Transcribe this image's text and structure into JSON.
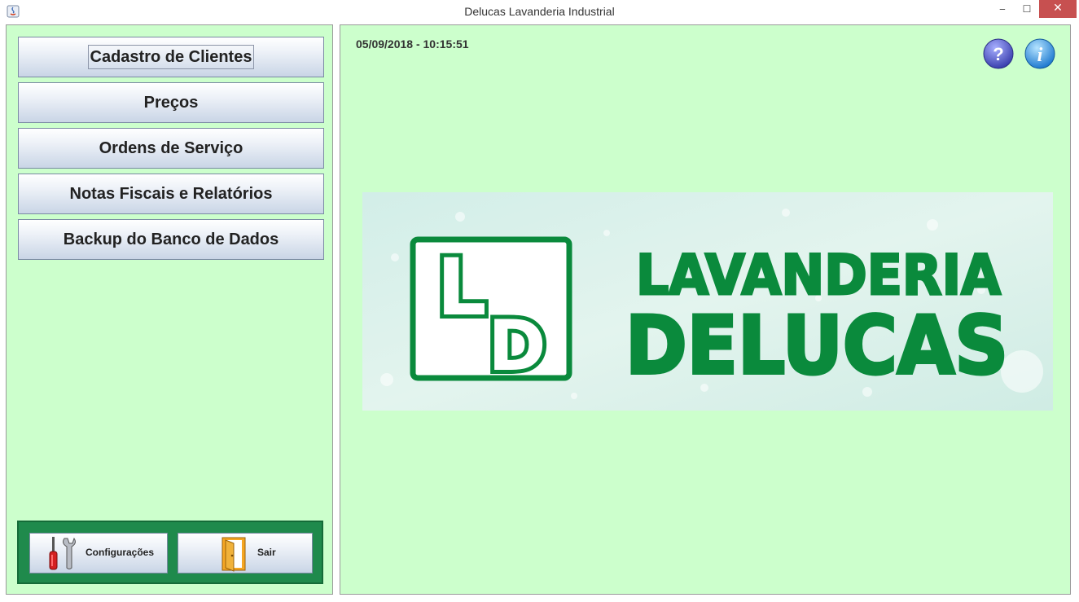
{
  "window": {
    "title": "Delucas Lavanderia Industrial",
    "minimize": "‒",
    "maximize": "☐",
    "close": "✕"
  },
  "menu": {
    "clients": "Cadastro de Clientes",
    "prices": "Preços",
    "orders": "Ordens de Serviço",
    "invoices": "Notas Fiscais e Relatórios",
    "backup": "Backup do Banco de Dados"
  },
  "footer": {
    "settings_label": "Configurações",
    "exit_label": "Sair"
  },
  "main": {
    "datetime": "05/09/2018 - 10:15:51",
    "help_glyph": "?",
    "info_glyph": "i"
  },
  "logo": {
    "monogram_top": "L",
    "monogram_bottom": "D",
    "line1": "LAVANDERIA",
    "line2": "DELUCAS"
  },
  "colors": {
    "panel_bg": "#ccffcc",
    "footer_green": "#1f8a4c",
    "logo_green": "#0a8a3c",
    "close_red": "#c75050"
  },
  "icons": [
    "java-app-icon",
    "tools-icon",
    "door-exit-icon",
    "help-icon",
    "info-icon"
  ]
}
